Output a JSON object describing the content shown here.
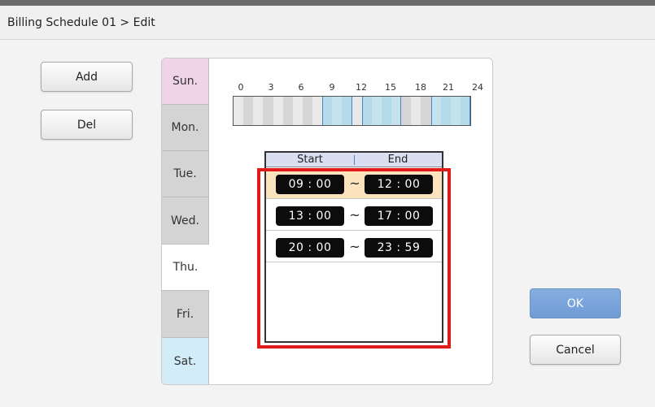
{
  "window": {
    "title": "Billing Schedule 01 > Edit"
  },
  "actions": {
    "add_label": "Add",
    "del_label": "Del",
    "ok_label": "OK",
    "cancel_label": "Cancel"
  },
  "days": [
    {
      "label": "Sun.",
      "color": "#efd3e8"
    },
    {
      "label": "Mon.",
      "color": "#d4d4d4"
    },
    {
      "label": "Tue.",
      "color": "#d4d4d4"
    },
    {
      "label": "Wed.",
      "color": "#d4d4d4"
    },
    {
      "label": "Thu.",
      "color": "#ffffff",
      "selected": true
    },
    {
      "label": "Fri.",
      "color": "#d4d4d4"
    },
    {
      "label": "Sat.",
      "color": "#d2ecf8"
    }
  ],
  "timeline": {
    "hour_labels": [
      "0",
      "3",
      "6",
      "9",
      "12",
      "15",
      "18",
      "21",
      "24"
    ],
    "active_hours": [
      [
        9,
        12
      ],
      [
        13,
        17
      ],
      [
        20,
        24
      ]
    ]
  },
  "schedule": {
    "start_header": "Start",
    "end_header": "End",
    "separator": "~",
    "entries": [
      {
        "start": "09 : 00",
        "end": "12 : 00",
        "selected": true
      },
      {
        "start": "13 : 00",
        "end": "17 : 00"
      },
      {
        "start": "20 : 00",
        "end": "23 : 59"
      }
    ]
  },
  "colors": {
    "accent_blue": "#779fd9",
    "selected_row": "#fbe3bd",
    "annotation_red": "#e11a1a",
    "timeline_active": "#c4e3ef",
    "timeline_light": "#e9e9e9",
    "timeline_dark": "#d6d6d6"
  }
}
